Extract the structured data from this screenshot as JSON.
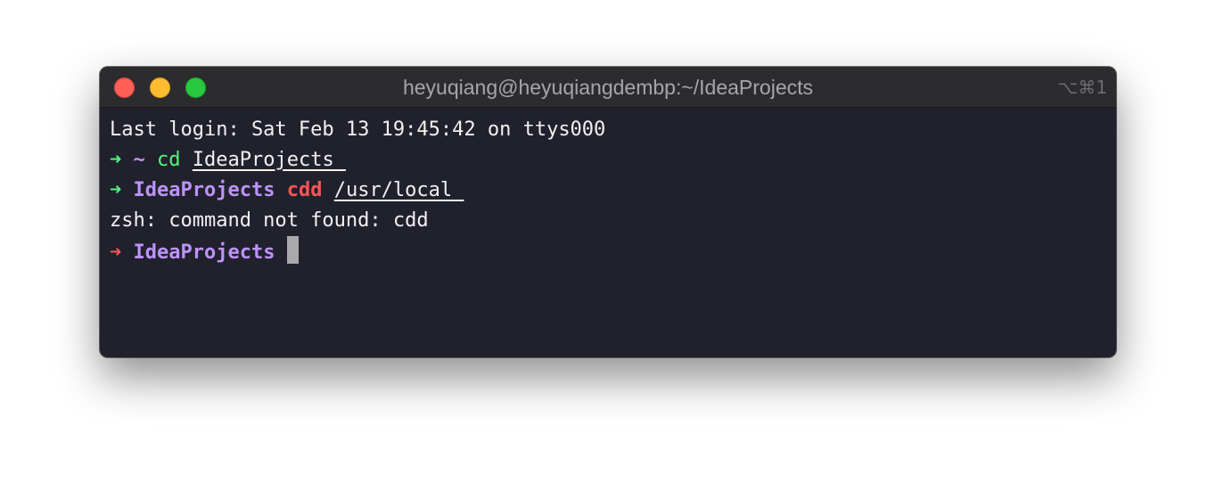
{
  "window": {
    "title": "heyuqiang@heyuqiangdembp:~/IdeaProjects",
    "shortcut": "⌥⌘1",
    "colors": {
      "background": "#20212d",
      "titlebar": "#2c2c2f",
      "close": "#fe5f57",
      "minimize": "#febc2e",
      "zoom": "#28c840"
    }
  },
  "terminal": {
    "login_line": "Last login: Sat Feb 13 19:45:42 on ttys000",
    "line1": {
      "arrow": "➜",
      "dir": "~",
      "command": "cd",
      "argument": "IdeaProjects "
    },
    "line2": {
      "arrow": "➜",
      "dir": "IdeaProjects",
      "command": "cdd",
      "argument": "/usr/local "
    },
    "error_line": "zsh: command not found: cdd",
    "line3": {
      "arrow": "➜",
      "dir": "IdeaProjects"
    },
    "colors": {
      "success_arrow": "#50fa7b",
      "error_arrow": "#ff5555",
      "directory": "#bd93f9",
      "valid_command": "#50fa7b",
      "invalid_command": "#ff5555"
    }
  }
}
